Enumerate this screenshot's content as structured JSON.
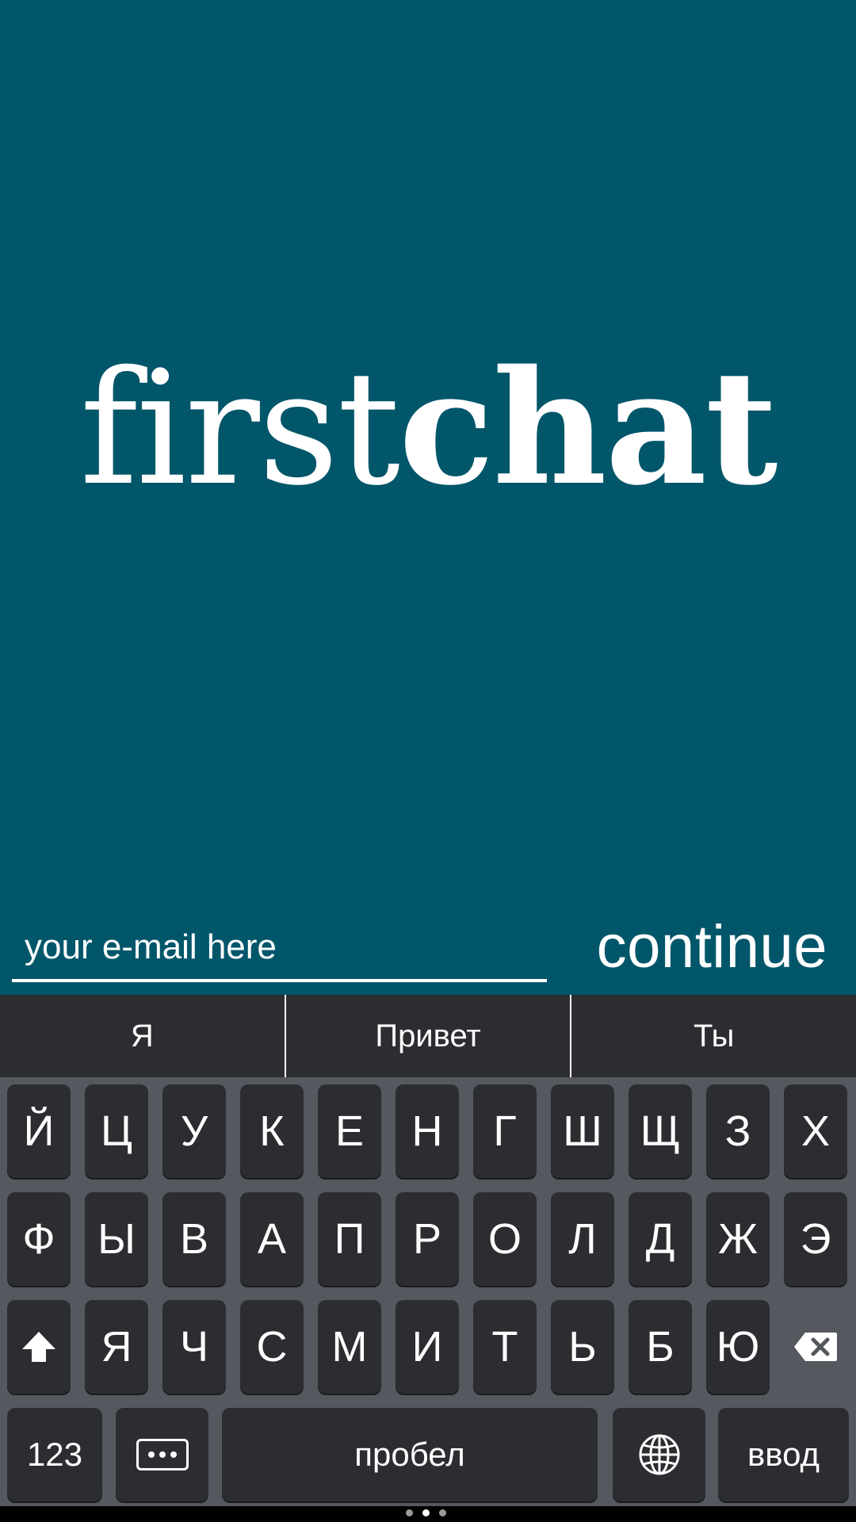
{
  "logo": {
    "light": "first",
    "bold": "chat"
  },
  "email": {
    "placeholder": "your e-mail here",
    "value": ""
  },
  "continue_label": "continue",
  "suggestions": [
    "Я",
    "Привет",
    "Ты"
  ],
  "keyboard": {
    "row1": [
      "Й",
      "Ц",
      "У",
      "К",
      "Е",
      "Н",
      "Г",
      "Ш",
      "Щ",
      "З",
      "Х"
    ],
    "row2": [
      "Ф",
      "Ы",
      "В",
      "А",
      "П",
      "Р",
      "О",
      "Л",
      "Д",
      "Ж",
      "Э"
    ],
    "row3": [
      "Я",
      "Ч",
      "С",
      "М",
      "И",
      "Т",
      "Ь",
      "Б",
      "Ю"
    ],
    "numbers_label": "123",
    "space_label": "пробел",
    "enter_label": "ввод",
    "icons": {
      "shift": "shift-icon",
      "delete": "backspace-icon",
      "globe": "globe-icon",
      "more": "more-icon"
    }
  },
  "colors": {
    "background": "#01566a",
    "keyboard_bg": "#55585f",
    "key_bg": "#2b2d31"
  },
  "pager": {
    "count": 3,
    "active": 1
  }
}
